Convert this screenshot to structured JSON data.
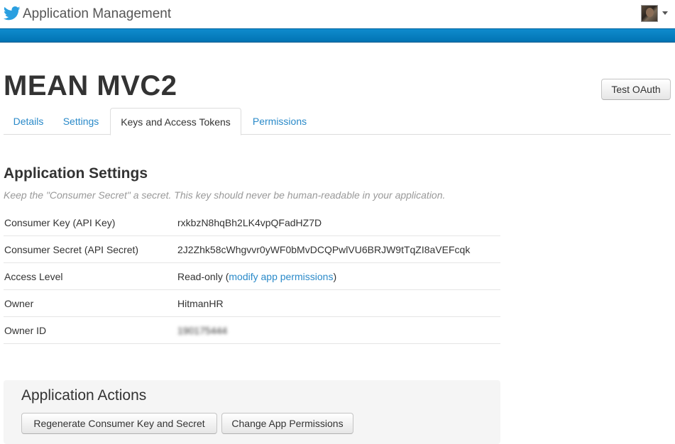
{
  "header": {
    "title": "Application Management",
    "logo_icon": "twitter-bird-icon",
    "avatar_icon": "user-avatar",
    "menu_icon": "caret-down-icon",
    "accent_color": "#0173b3"
  },
  "app": {
    "name": "MEAN MVC2",
    "test_oauth_label": "Test OAuth"
  },
  "tabs": [
    {
      "label": "Details",
      "active": false
    },
    {
      "label": "Settings",
      "active": false
    },
    {
      "label": "Keys and Access Tokens",
      "active": true
    },
    {
      "label": "Permissions",
      "active": false
    }
  ],
  "settings": {
    "heading": "Application Settings",
    "note": "Keep the \"Consumer Secret\" a secret. This key should never be human-readable in your application.",
    "rows": [
      {
        "label": "Consumer Key (API Key)",
        "value": "rxkbzN8hqBh2LK4vpQFadHZ7D"
      },
      {
        "label": "Consumer Secret (API Secret)",
        "value": "2J2Zhk58cWhgvvr0yWF0bMvDCQPwlVU6BRJW9tTqZI8aVEFcqk"
      },
      {
        "label": "Access Level",
        "value": "Read-only",
        "value_open": " (",
        "link": "modify app permissions",
        "value_close": ")"
      },
      {
        "label": "Owner",
        "value": "HitmanHR"
      },
      {
        "label": "Owner ID",
        "value": "190175444"
      }
    ]
  },
  "actions": {
    "heading": "Application Actions",
    "regenerate_label": "Regenerate Consumer Key and Secret",
    "change_permissions_label": "Change App Permissions"
  }
}
